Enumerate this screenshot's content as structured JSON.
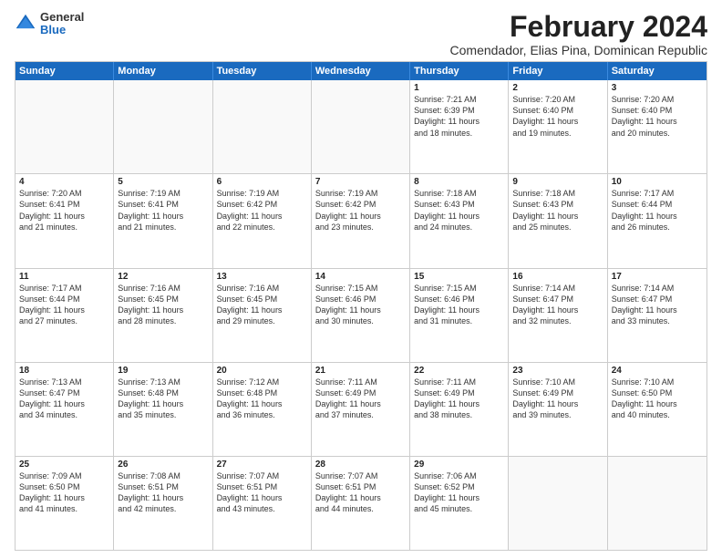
{
  "header": {
    "logo_general": "General",
    "logo_blue": "Blue",
    "main_title": "February 2024",
    "subtitle": "Comendador, Elias Pina, Dominican Republic"
  },
  "calendar": {
    "days_of_week": [
      "Sunday",
      "Monday",
      "Tuesday",
      "Wednesday",
      "Thursday",
      "Friday",
      "Saturday"
    ],
    "weeks": [
      [
        {
          "day": "",
          "empty": true
        },
        {
          "day": "",
          "empty": true
        },
        {
          "day": "",
          "empty": true
        },
        {
          "day": "",
          "empty": true
        },
        {
          "day": "1",
          "lines": [
            "Sunrise: 7:21 AM",
            "Sunset: 6:39 PM",
            "Daylight: 11 hours",
            "and 18 minutes."
          ]
        },
        {
          "day": "2",
          "lines": [
            "Sunrise: 7:20 AM",
            "Sunset: 6:40 PM",
            "Daylight: 11 hours",
            "and 19 minutes."
          ]
        },
        {
          "day": "3",
          "lines": [
            "Sunrise: 7:20 AM",
            "Sunset: 6:40 PM",
            "Daylight: 11 hours",
            "and 20 minutes."
          ]
        }
      ],
      [
        {
          "day": "4",
          "lines": [
            "Sunrise: 7:20 AM",
            "Sunset: 6:41 PM",
            "Daylight: 11 hours",
            "and 21 minutes."
          ]
        },
        {
          "day": "5",
          "lines": [
            "Sunrise: 7:19 AM",
            "Sunset: 6:41 PM",
            "Daylight: 11 hours",
            "and 21 minutes."
          ]
        },
        {
          "day": "6",
          "lines": [
            "Sunrise: 7:19 AM",
            "Sunset: 6:42 PM",
            "Daylight: 11 hours",
            "and 22 minutes."
          ]
        },
        {
          "day": "7",
          "lines": [
            "Sunrise: 7:19 AM",
            "Sunset: 6:42 PM",
            "Daylight: 11 hours",
            "and 23 minutes."
          ]
        },
        {
          "day": "8",
          "lines": [
            "Sunrise: 7:18 AM",
            "Sunset: 6:43 PM",
            "Daylight: 11 hours",
            "and 24 minutes."
          ]
        },
        {
          "day": "9",
          "lines": [
            "Sunrise: 7:18 AM",
            "Sunset: 6:43 PM",
            "Daylight: 11 hours",
            "and 25 minutes."
          ]
        },
        {
          "day": "10",
          "lines": [
            "Sunrise: 7:17 AM",
            "Sunset: 6:44 PM",
            "Daylight: 11 hours",
            "and 26 minutes."
          ]
        }
      ],
      [
        {
          "day": "11",
          "lines": [
            "Sunrise: 7:17 AM",
            "Sunset: 6:44 PM",
            "Daylight: 11 hours",
            "and 27 minutes."
          ]
        },
        {
          "day": "12",
          "lines": [
            "Sunrise: 7:16 AM",
            "Sunset: 6:45 PM",
            "Daylight: 11 hours",
            "and 28 minutes."
          ]
        },
        {
          "day": "13",
          "lines": [
            "Sunrise: 7:16 AM",
            "Sunset: 6:45 PM",
            "Daylight: 11 hours",
            "and 29 minutes."
          ]
        },
        {
          "day": "14",
          "lines": [
            "Sunrise: 7:15 AM",
            "Sunset: 6:46 PM",
            "Daylight: 11 hours",
            "and 30 minutes."
          ]
        },
        {
          "day": "15",
          "lines": [
            "Sunrise: 7:15 AM",
            "Sunset: 6:46 PM",
            "Daylight: 11 hours",
            "and 31 minutes."
          ]
        },
        {
          "day": "16",
          "lines": [
            "Sunrise: 7:14 AM",
            "Sunset: 6:47 PM",
            "Daylight: 11 hours",
            "and 32 minutes."
          ]
        },
        {
          "day": "17",
          "lines": [
            "Sunrise: 7:14 AM",
            "Sunset: 6:47 PM",
            "Daylight: 11 hours",
            "and 33 minutes."
          ]
        }
      ],
      [
        {
          "day": "18",
          "lines": [
            "Sunrise: 7:13 AM",
            "Sunset: 6:47 PM",
            "Daylight: 11 hours",
            "and 34 minutes."
          ]
        },
        {
          "day": "19",
          "lines": [
            "Sunrise: 7:13 AM",
            "Sunset: 6:48 PM",
            "Daylight: 11 hours",
            "and 35 minutes."
          ]
        },
        {
          "day": "20",
          "lines": [
            "Sunrise: 7:12 AM",
            "Sunset: 6:48 PM",
            "Daylight: 11 hours",
            "and 36 minutes."
          ]
        },
        {
          "day": "21",
          "lines": [
            "Sunrise: 7:11 AM",
            "Sunset: 6:49 PM",
            "Daylight: 11 hours",
            "and 37 minutes."
          ]
        },
        {
          "day": "22",
          "lines": [
            "Sunrise: 7:11 AM",
            "Sunset: 6:49 PM",
            "Daylight: 11 hours",
            "and 38 minutes."
          ]
        },
        {
          "day": "23",
          "lines": [
            "Sunrise: 7:10 AM",
            "Sunset: 6:49 PM",
            "Daylight: 11 hours",
            "and 39 minutes."
          ]
        },
        {
          "day": "24",
          "lines": [
            "Sunrise: 7:10 AM",
            "Sunset: 6:50 PM",
            "Daylight: 11 hours",
            "and 40 minutes."
          ]
        }
      ],
      [
        {
          "day": "25",
          "lines": [
            "Sunrise: 7:09 AM",
            "Sunset: 6:50 PM",
            "Daylight: 11 hours",
            "and 41 minutes."
          ]
        },
        {
          "day": "26",
          "lines": [
            "Sunrise: 7:08 AM",
            "Sunset: 6:51 PM",
            "Daylight: 11 hours",
            "and 42 minutes."
          ]
        },
        {
          "day": "27",
          "lines": [
            "Sunrise: 7:07 AM",
            "Sunset: 6:51 PM",
            "Daylight: 11 hours",
            "and 43 minutes."
          ]
        },
        {
          "day": "28",
          "lines": [
            "Sunrise: 7:07 AM",
            "Sunset: 6:51 PM",
            "Daylight: 11 hours",
            "and 44 minutes."
          ]
        },
        {
          "day": "29",
          "lines": [
            "Sunrise: 7:06 AM",
            "Sunset: 6:52 PM",
            "Daylight: 11 hours",
            "and 45 minutes."
          ]
        },
        {
          "day": "",
          "empty": true
        },
        {
          "day": "",
          "empty": true
        }
      ]
    ]
  }
}
